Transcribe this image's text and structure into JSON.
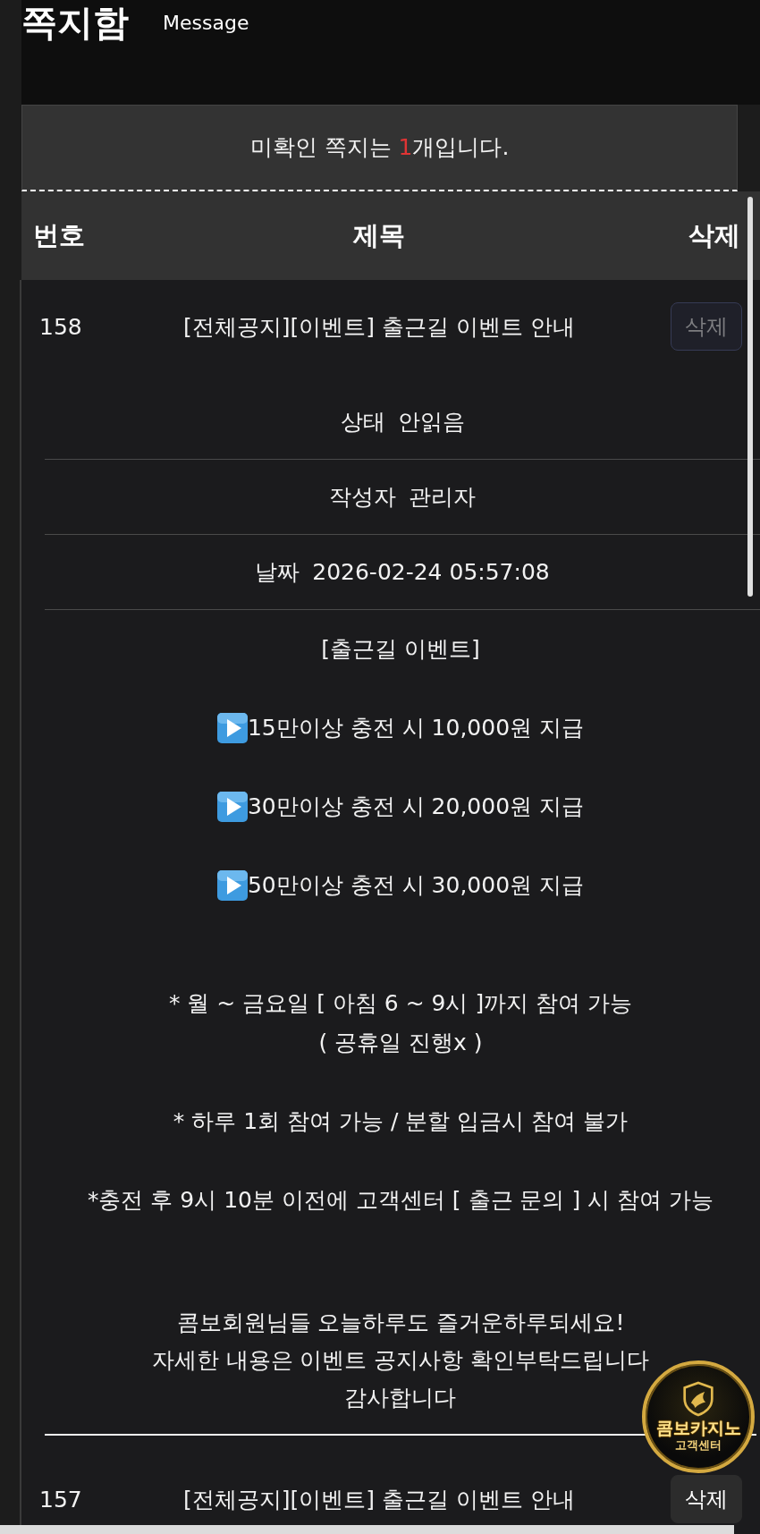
{
  "header": {
    "title": "쪽지함",
    "subtitle": "Message"
  },
  "unread_notice": {
    "before": "미확인 쪽지는 ",
    "count": "1",
    "after": "개입니다."
  },
  "table": {
    "columns": [
      "번호",
      "제목",
      "삭제"
    ],
    "rows": [
      {
        "number": "158",
        "title": "[전체공지][이벤트] 출근길 이벤트 안내",
        "delete_button": {
          "label": "삭제",
          "disabled": true
        },
        "details": [
          {
            "label": "상태",
            "value": "안읽음"
          },
          {
            "label": "작성자",
            "value": "관리자"
          },
          {
            "label": "날짜",
            "value": "2026-02-24 05:57:08"
          }
        ],
        "body": [
          {
            "kind": "heading",
            "lines": [
              "[출근길 이벤트]"
            ]
          },
          {
            "kind": "bullet",
            "lines": [
              "15만이상 충전 시 10,000원 지급"
            ]
          },
          {
            "kind": "bullet",
            "lines": [
              "30만이상 충전 시 20,000원 지급"
            ]
          },
          {
            "kind": "bullet",
            "lines": [
              "50만이상 충전 시 30,000원 지급"
            ]
          },
          {
            "kind": "note",
            "lines": [
              "* 월 ~ 금요일 [ 아침 6 ~ 9시 ]까지 참여 가능",
              "( 공휴일 진행x )"
            ]
          },
          {
            "kind": "note",
            "lines": [
              "* 하루 1회 참여 가능 / 분할 입금시 참여 불가"
            ]
          },
          {
            "kind": "note",
            "lines": [
              "*충전 후 9시 10분 이전에 고객센터 [ 출근 문의 ] 시 참여 가능"
            ]
          },
          {
            "kind": "closing",
            "lines": [
              "콤보회원님들 오늘하루도 즐거운하루되세요!",
              "자세한 내용은 이벤트 공지사항 확인부탁드립니다",
              "감사합니다"
            ]
          }
        ]
      },
      {
        "number": "157",
        "title": "[전체공지][이벤트] 출근길 이벤트 안내",
        "delete_button": {
          "label": "삭제",
          "disabled": false
        }
      }
    ]
  },
  "support_badge": {
    "title": "콤보카지노",
    "subtitle": "고객센터"
  }
}
